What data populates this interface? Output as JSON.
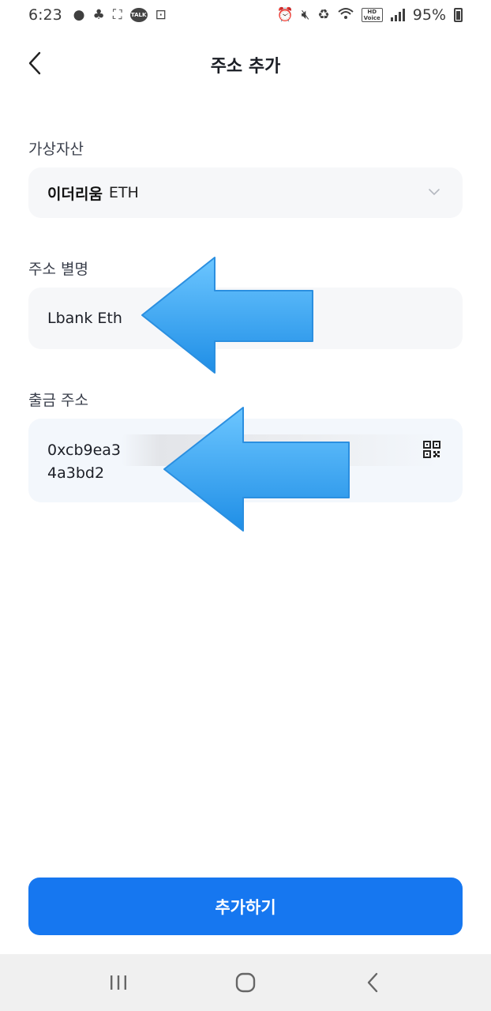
{
  "status_bar": {
    "time": "6:23",
    "talk_badge": "TALK",
    "hd_top": "HD",
    "hd_bottom": "Voice",
    "battery": "95%"
  },
  "header": {
    "title": "주소 추가"
  },
  "form": {
    "asset_label": "가상자산",
    "asset_name": "이더리움",
    "asset_symbol": "ETH",
    "alias_label": "주소 별명",
    "alias_value": "Lbank Eth",
    "address_label": "출금 주소",
    "address_line1": "0xcb9ea3",
    "address_line2": "4a3bd2"
  },
  "submit": {
    "label": "추가하기"
  },
  "colors": {
    "accent": "#1677f0",
    "arrow": "#3aa8f0",
    "field_bg": "#f6f7f9"
  },
  "icons": [
    "back-arrow-icon",
    "chevron-down-icon",
    "qr-scan-icon",
    "recent-apps-icon",
    "home-icon",
    "nav-back-icon"
  ]
}
